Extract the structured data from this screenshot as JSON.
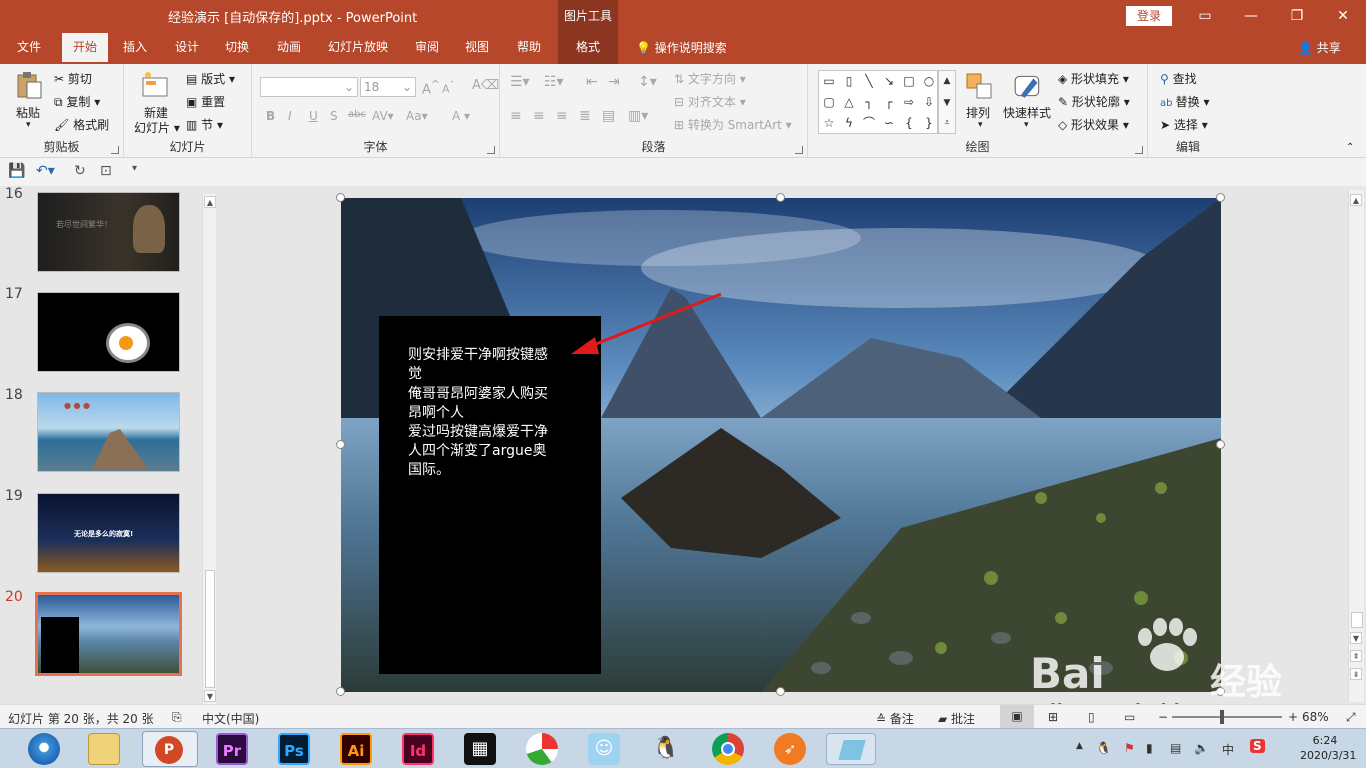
{
  "titlebar": {
    "title": "经验演示 [自动保存的].pptx  -  PowerPoint",
    "context_tab": "图片工具",
    "login": "登录"
  },
  "tabs": [
    {
      "label": "文件"
    },
    {
      "label": "开始"
    },
    {
      "label": "插入"
    },
    {
      "label": "设计"
    },
    {
      "label": "切换"
    },
    {
      "label": "动画"
    },
    {
      "label": "幻灯片放映"
    },
    {
      "label": "审阅"
    },
    {
      "label": "视图"
    },
    {
      "label": "帮助"
    },
    {
      "label": "格式"
    }
  ],
  "tellme": "操作说明搜索",
  "share": "共享",
  "ribbon": {
    "clipboard": {
      "paste": "粘贴",
      "cut": "剪切",
      "copy": "复制",
      "format_painter": "格式刷",
      "label": "剪贴板"
    },
    "slides": {
      "new_slide_1": "新建",
      "new_slide_2": "幻灯片",
      "layout": "版式",
      "reset": "重置",
      "section": "节",
      "label": "幻灯片"
    },
    "font": {
      "size": "18",
      "label": "字体",
      "bold": "B",
      "italic": "I",
      "underline": "U",
      "shadow": "S",
      "strike": "abc",
      "spacing": "AV",
      "case": "Aa",
      "grow": "A",
      "shrink": "A",
      "clear": "A",
      "color": "A"
    },
    "paragraph": {
      "text_direction": "文字方向",
      "align_text": "对齐文本",
      "smartart": "转换为 SmartArt",
      "label": "段落"
    },
    "drawing": {
      "arrange": "排列",
      "quick_styles": "快速样式",
      "fill": "形状填充",
      "outline": "形状轮廓",
      "effects": "形状效果",
      "label": "绘图"
    },
    "editing": {
      "find": "查找",
      "replace": "替换",
      "select": "选择",
      "label": "编辑"
    }
  },
  "thumbnails": [
    {
      "num": "16",
      "caption": "若尽世间繁华！"
    },
    {
      "num": "17"
    },
    {
      "num": "18"
    },
    {
      "num": "19",
      "caption": "无论是多么的寂寞!"
    },
    {
      "num": "20"
    }
  ],
  "slide": {
    "lines": [
      "则安排爱干净啊按键感",
      "觉",
      "俺哥哥昂阿婆家人购买",
      "昂啊个人",
      "爱过吗按键高爆爱干净",
      "人四个渐变了argue奥",
      "国际。"
    ]
  },
  "status": {
    "slide_info": "幻灯片 第 20 张，共 20 张",
    "language": "中文(中国)",
    "notes": "备注",
    "comments": "批注",
    "zoom": "68%"
  },
  "taskbar": {
    "apps": [
      "Pr",
      "Ps",
      "Ai",
      "Id"
    ],
    "ime": "中",
    "time": "6:24",
    "date": "2020/3/31"
  },
  "watermark": {
    "brand": "Bai",
    "brand2": "经验",
    "url": "jingyan.baidu.com"
  },
  "colors": {
    "accent": "#b7472a",
    "context": "#8c3520",
    "current_slide": "#e4714f",
    "taskbar": "#c8d7e6"
  }
}
